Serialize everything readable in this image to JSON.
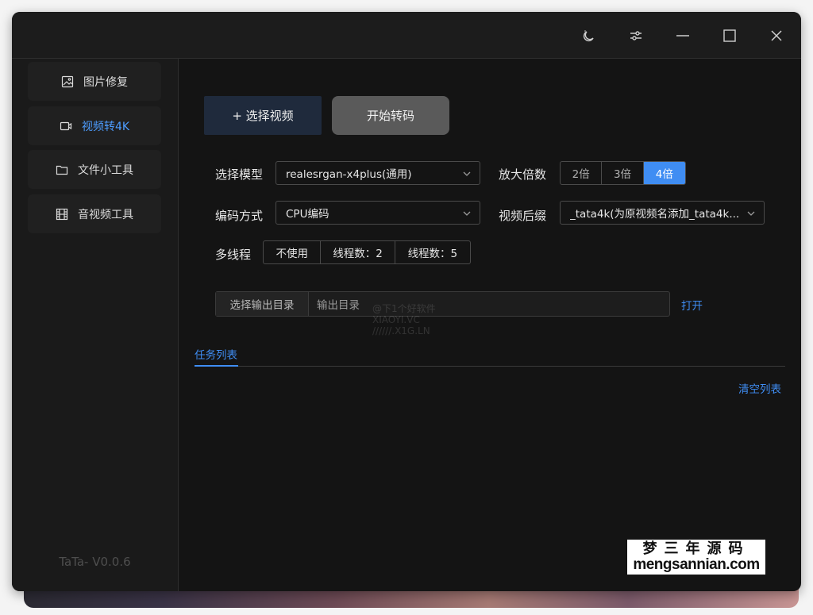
{
  "titlebar": {
    "icons": [
      "theme-moon-icon",
      "settings-sliders-icon",
      "minimize-icon",
      "maximize-icon",
      "close-icon"
    ]
  },
  "sidebar": {
    "items": [
      {
        "label": "图片修复",
        "icon": "image-icon",
        "active": false
      },
      {
        "label": "视频转4K",
        "icon": "video-camera-icon",
        "active": true
      },
      {
        "label": "文件小工具",
        "icon": "folder-icon",
        "active": false
      },
      {
        "label": "音视频工具",
        "icon": "film-icon",
        "active": false
      }
    ],
    "version": "TaTa- V0.0.6"
  },
  "actions": {
    "select_video": "+ 选择视频",
    "start_convert": "开始转码"
  },
  "form": {
    "model_label": "选择模型",
    "model_value": "realesrgan-x4plus(通用)",
    "scale_label": "放大倍数",
    "scale_options": [
      "2倍",
      "3倍",
      "4倍"
    ],
    "scale_selected": "4倍",
    "encode_label": "编码方式",
    "encode_value": "CPU编码",
    "suffix_label": "视频后缀",
    "suffix_value": "_tata4k(为原视频名添加_tata4k...",
    "thread_label": "多线程",
    "thread_options": [
      "不使用",
      "线程数：2",
      "线程数：5"
    ],
    "outdir_button": "选择输出目录",
    "outdir_placeholder": "输出目录",
    "open_link": "打开"
  },
  "watermark": {
    "line1": "@下1个好软件",
    "line2": "XIAOYI.VC",
    "line3": "//////.X1G.LN"
  },
  "tasks": {
    "tab_label": "任务列表",
    "clear_link": "清空列表"
  },
  "stamp": {
    "cn": "梦三年源码",
    "en": "mengsannian.com"
  },
  "colors": {
    "accent": "#3f8df3",
    "background": "#141414",
    "sidebar": "#1a1a1a"
  }
}
